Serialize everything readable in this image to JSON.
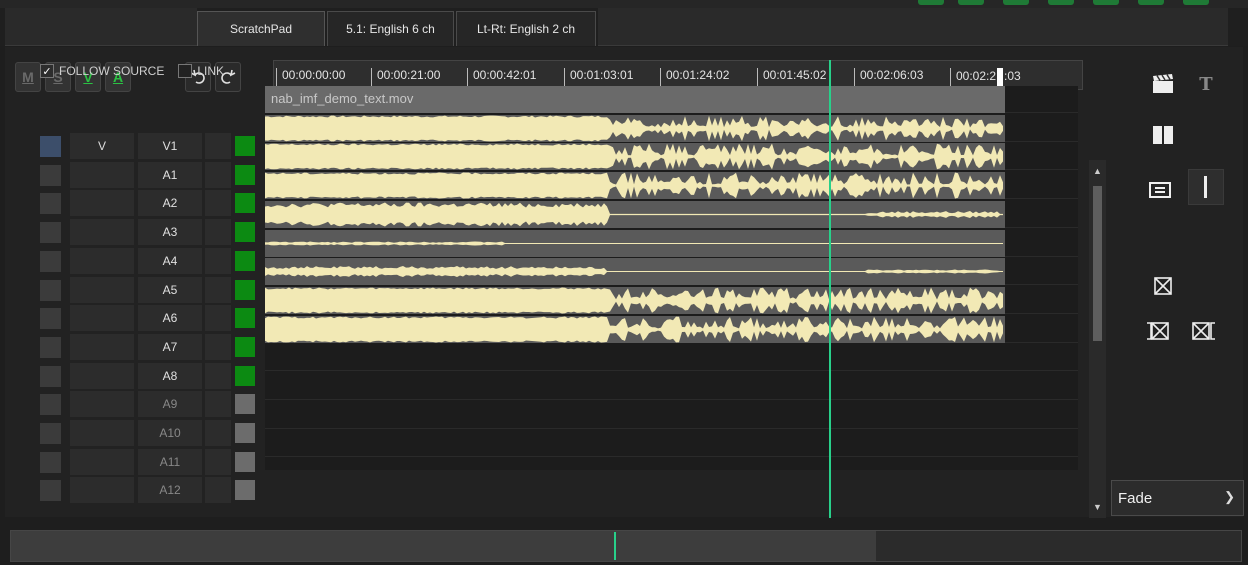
{
  "tabs": [
    {
      "label": "ScratchPad",
      "active": true
    },
    {
      "label": "5.1: English 6 ch",
      "active": false
    },
    {
      "label": "Lt-Rt: English 2 ch",
      "active": false
    }
  ],
  "toolbar": {
    "m_label": "M",
    "s_label": "S",
    "v_label": "V",
    "a_label": "A",
    "undo_icon": "undo-icon",
    "redo_icon": "redo-icon"
  },
  "ruler": {
    "timecodes": [
      "00:00:00:00",
      "00:00:21:00",
      "00:00:42:01",
      "00:01:03:01",
      "00:01:24:02",
      "00:01:45:02",
      "00:02:06:03",
      "00:02:2"
    ],
    "last_suffix": ":03"
  },
  "options": {
    "follow_source": {
      "label": "FOLLOW SOURCE",
      "checked": true
    },
    "link": {
      "label": "LINK",
      "checked": false
    }
  },
  "video_track": {
    "source_label": "V",
    "label": "V1",
    "clip_name": "nab_imf_demo_text.mov"
  },
  "audio_tracks": [
    {
      "label": "A1",
      "active": true
    },
    {
      "label": "A2",
      "active": true
    },
    {
      "label": "A3",
      "active": true
    },
    {
      "label": "A4",
      "active": true
    },
    {
      "label": "A5",
      "active": true
    },
    {
      "label": "A6",
      "active": true
    },
    {
      "label": "A7",
      "active": true
    },
    {
      "label": "A8",
      "active": true
    },
    {
      "label": "A9",
      "active": false
    },
    {
      "label": "A10",
      "active": false
    },
    {
      "label": "A11",
      "active": false
    },
    {
      "label": "A12",
      "active": false
    }
  ],
  "transition": {
    "selected": "Fade"
  },
  "colors": {
    "accent_green": "#28d08a",
    "active_track": "#0c8a12",
    "waveform": "#f2e9b5"
  }
}
